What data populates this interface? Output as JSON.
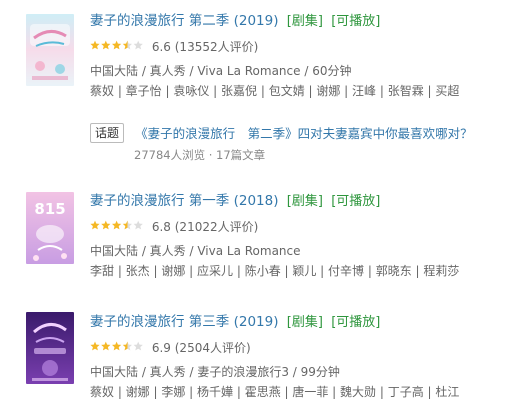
{
  "results": [
    {
      "title": "妻子的浪漫旅行 第二季 (2019)",
      "tags": [
        "[剧集]",
        "[可播放]"
      ],
      "rating": "6.6",
      "rating_count": "(13552人评价)",
      "stars": 3.5,
      "meta": "中国大陆 / 真人秀 / Viva La Romance / 60分钟",
      "cast": "蔡奴 | 章子怡 | 袁咏仪 | 张嘉倪 | 包文婧 | 谢娜 | 汪峰 | 张智霖 | 买超"
    },
    {
      "title": "妻子的浪漫旅行 第一季 (2018)",
      "tags": [
        "[剧集]",
        "[可播放]"
      ],
      "rating": "6.8",
      "rating_count": "(21022人评价)",
      "stars": 3.5,
      "meta": "中国大陆 / 真人秀 / Viva La Romance",
      "cast": "李甜 | 张杰 | 谢娜 | 应采儿 | 陈小春 | 颖儿 | 付辛博 | 郭晓东 | 程莉莎"
    },
    {
      "title": "妻子的浪漫旅行 第三季 (2019)",
      "tags": [
        "[剧集]",
        "[可播放]"
      ],
      "rating": "6.9",
      "rating_count": "(2504人评价)",
      "stars": 3.5,
      "meta": "中国大陆 / 真人秀 / 妻子的浪漫旅行3 / 99分钟",
      "cast": "蔡奴 | 谢娜 | 李娜 | 杨千嬅 | 霍思燕 | 唐一菲 | 魏大勋 | 丁子高 | 杜江"
    }
  ],
  "topic": {
    "badge": "话题",
    "title": "《妻子的浪漫旅行　第二季》四对夫妻嘉宾中你最喜欢哪对？",
    "stats": "27784人浏览 · 17篇文章"
  },
  "colors": {
    "link": "#3377aa",
    "tag": "#2e963d",
    "star": "#f5b825",
    "star_empty": "#dddddd"
  }
}
